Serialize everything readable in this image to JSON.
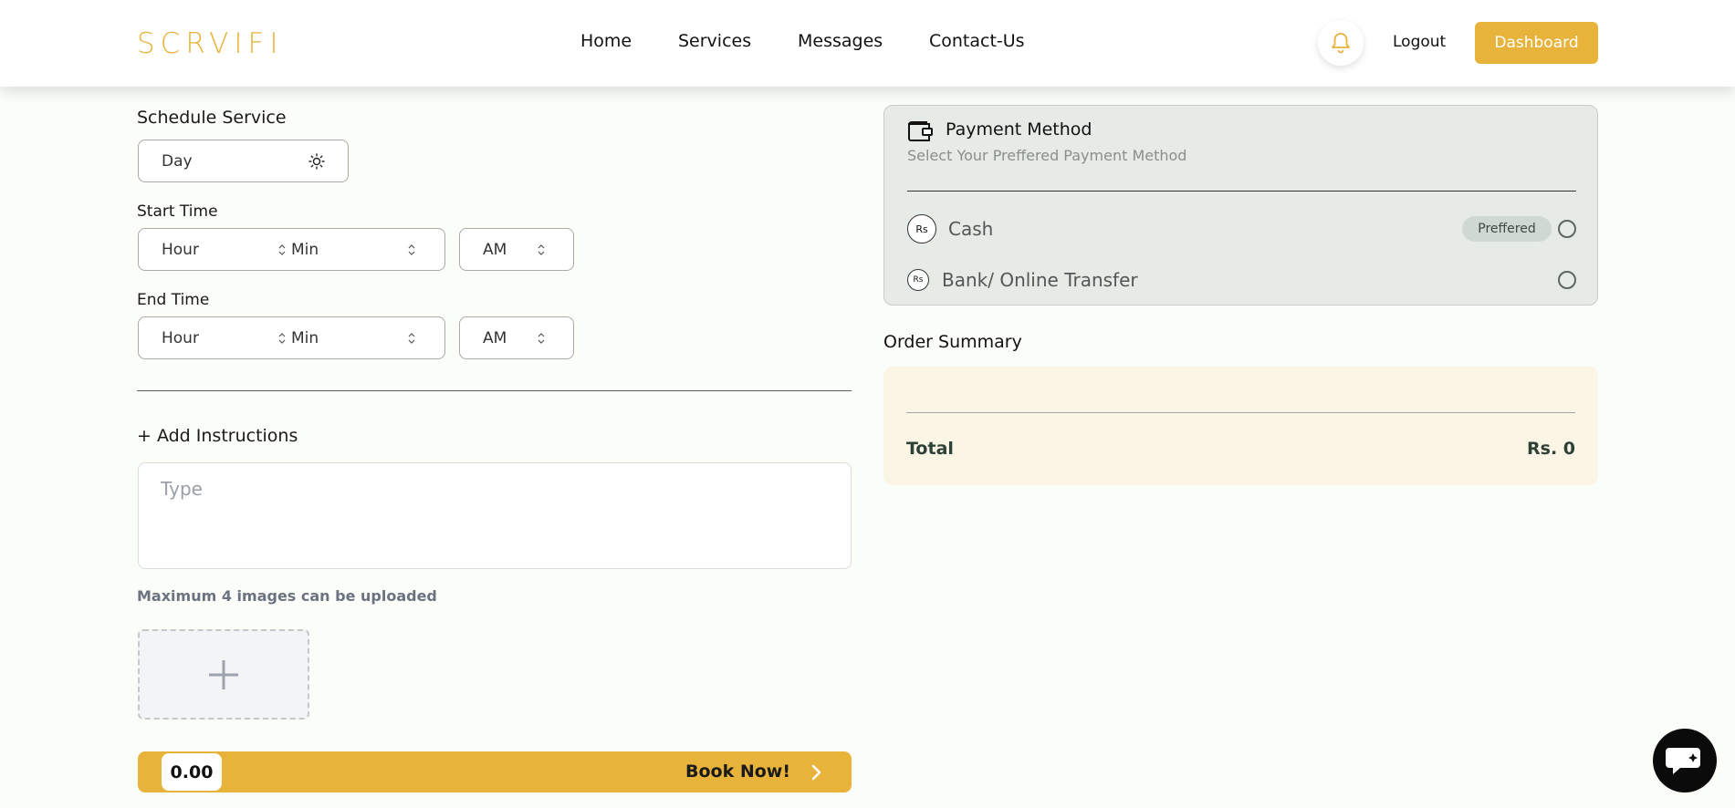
{
  "header": {
    "logo": "SCRVIFI",
    "nav": [
      "Home",
      "Services",
      "Messages",
      "Contact-Us"
    ],
    "logout_label": "Logout",
    "dashboard_label": "Dashboard"
  },
  "schedule": {
    "title": "Schedule Service",
    "day_value": "Day",
    "start_label": "Start Time",
    "end_label": "End Time",
    "start": {
      "hour": "Hour",
      "min": "Min",
      "ampm": "AM"
    },
    "end": {
      "hour": "Hour",
      "min": "Min",
      "ampm": "AM"
    }
  },
  "instructions": {
    "add_label": "+ Add Instructions",
    "placeholder": "Type",
    "upload_note": "Maximum 4 images can be uploaded"
  },
  "booking": {
    "price": "0.00",
    "book_label": "Book Now!"
  },
  "payment": {
    "title": "Payment Method",
    "subtitle": "Select Your Preffered Payment Method",
    "options": [
      {
        "label": "Cash",
        "badge": "Preffered",
        "icon_text": "Rs"
      },
      {
        "label": "Bank/ Online Transfer",
        "icon_text": "Rs"
      }
    ]
  },
  "summary": {
    "title": "Order Summary",
    "total_label": "Total",
    "total_value": "Rs. 0"
  },
  "colors": {
    "accent": "#e8b33a",
    "payment_bg": "#e6ebe7",
    "summary_bg": "#fbf5e6",
    "total_text": "#2d4137"
  },
  "icons": [
    "bell-icon",
    "sun-icon",
    "wallet-icon",
    "plus-icon",
    "chevron-right-icon",
    "chat-icon",
    "updown-icon"
  ]
}
